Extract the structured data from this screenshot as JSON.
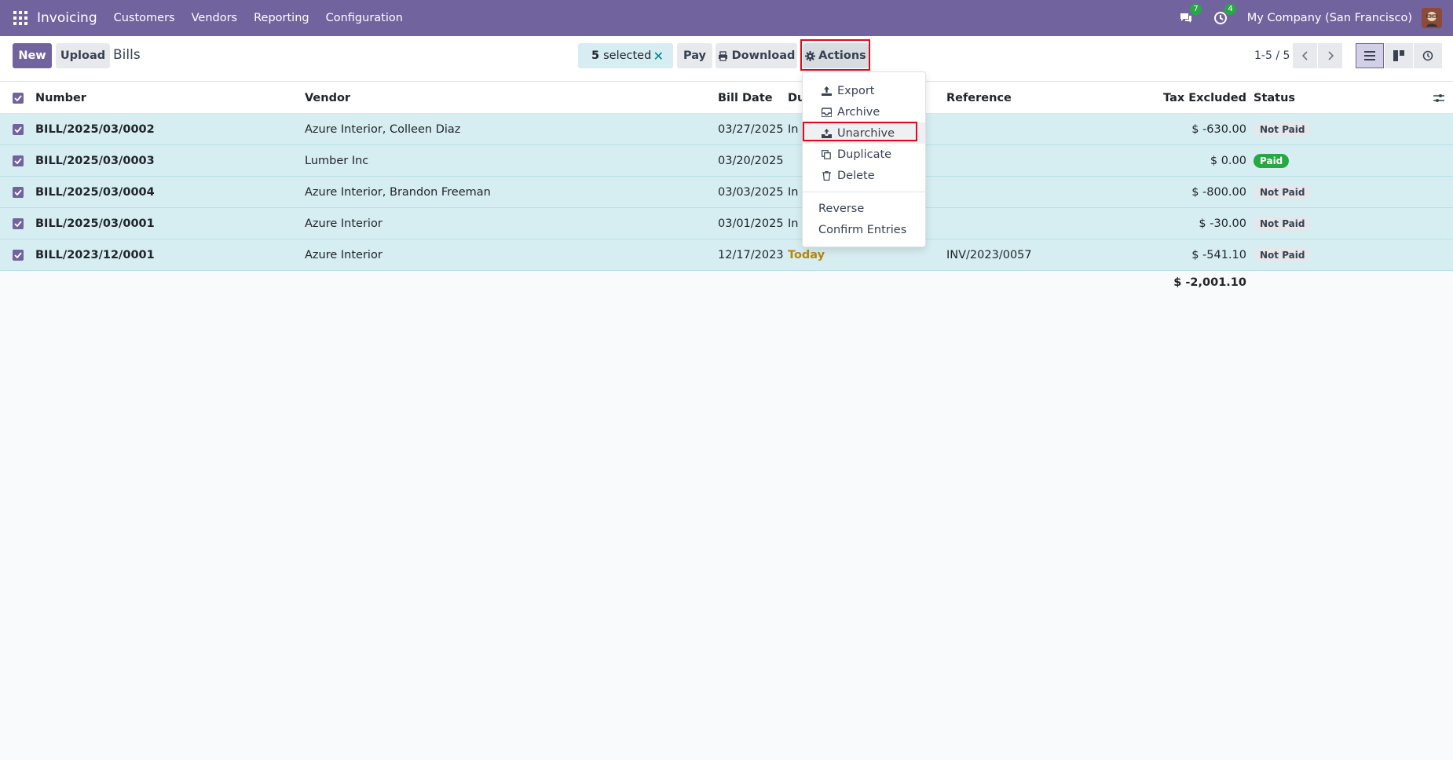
{
  "navbar": {
    "brand": "Invoicing",
    "menu": [
      "Customers",
      "Vendors",
      "Reporting",
      "Configuration"
    ],
    "messages_count": "7",
    "activities_count": "4",
    "company": "My Company (San Francisco)"
  },
  "control": {
    "new_label": "New",
    "upload_label": "Upload",
    "breadcrumb": "Bills",
    "selected_count": "5",
    "selected_label": "selected",
    "pay_label": "Pay",
    "download_label": "Download",
    "actions_label": "Actions",
    "pager": "1-5 / 5"
  },
  "table": {
    "headers": {
      "number": "Number",
      "vendor": "Vendor",
      "bill_date": "Bill Date",
      "due": "Du",
      "reference": "Reference",
      "tax_excluded": "Tax Excluded",
      "status": "Status"
    },
    "rows": [
      {
        "number": "BILL/2025/03/0002",
        "vendor": "Azure Interior, Colleen Diaz",
        "bill_date": "03/27/2025",
        "due": "In",
        "reference": "",
        "tax_excluded": "$ -630.00",
        "status": "Not Paid"
      },
      {
        "number": "BILL/2025/03/0003",
        "vendor": "Lumber Inc",
        "bill_date": "03/20/2025",
        "due": "",
        "reference": "",
        "tax_excluded": "$ 0.00",
        "status": "Paid"
      },
      {
        "number": "BILL/2025/03/0004",
        "vendor": "Azure Interior, Brandon Freeman",
        "bill_date": "03/03/2025",
        "due": "In",
        "reference": "",
        "tax_excluded": "$ -800.00",
        "status": "Not Paid"
      },
      {
        "number": "BILL/2025/03/0001",
        "vendor": "Azure Interior",
        "bill_date": "03/01/2025",
        "due": "In",
        "reference": "",
        "tax_excluded": "$ -30.00",
        "status": "Not Paid"
      },
      {
        "number": "BILL/2023/12/0001",
        "vendor": "Azure Interior",
        "bill_date": "12/17/2023",
        "due": "Today",
        "reference": "INV/2023/0057",
        "tax_excluded": "$ -541.10",
        "status": "Not Paid"
      }
    ],
    "total": "$ -2,001.10"
  },
  "actions_menu": {
    "items": [
      "Export",
      "Archive",
      "Unarchive",
      "Duplicate",
      "Delete"
    ],
    "extra": [
      "Reverse",
      "Confirm Entries"
    ]
  },
  "colors": {
    "navbar": "#71639e",
    "selected_row": "#d6eef2",
    "highlight": "#e1071a",
    "paid": "#28a745"
  }
}
